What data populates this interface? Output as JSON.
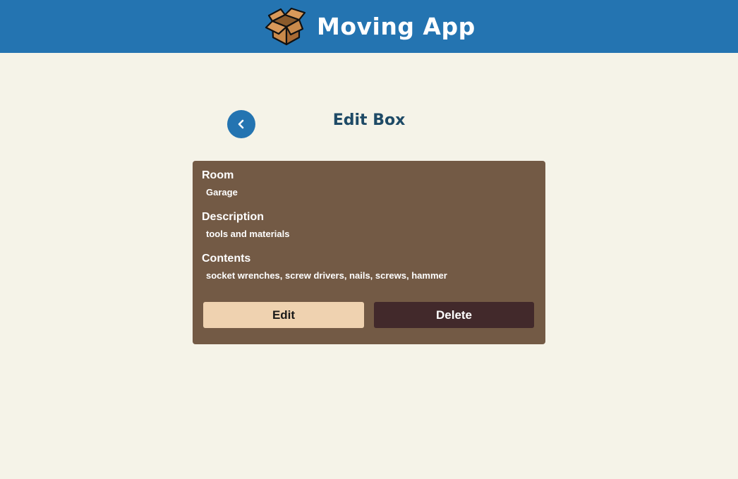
{
  "header": {
    "title": "Moving App",
    "logo_icon": "cardboard-box-icon"
  },
  "page": {
    "title": "Edit Box",
    "back_icon": "chevron-left-icon"
  },
  "box": {
    "room_label": "Room",
    "room_value": "Garage",
    "description_label": "Description",
    "description_value": "tools and materials",
    "contents_label": "Contents",
    "contents_value": "socket wrenches, screw drivers, nails, screws, hammer"
  },
  "actions": {
    "edit_label": "Edit",
    "delete_label": "Delete"
  },
  "colors": {
    "header": "#2474b1",
    "background": "#f5f3e8",
    "card": "#735a45",
    "edit_button": "#efd2b0",
    "delete_button": "#42292b",
    "title_text": "#1e4a66"
  }
}
